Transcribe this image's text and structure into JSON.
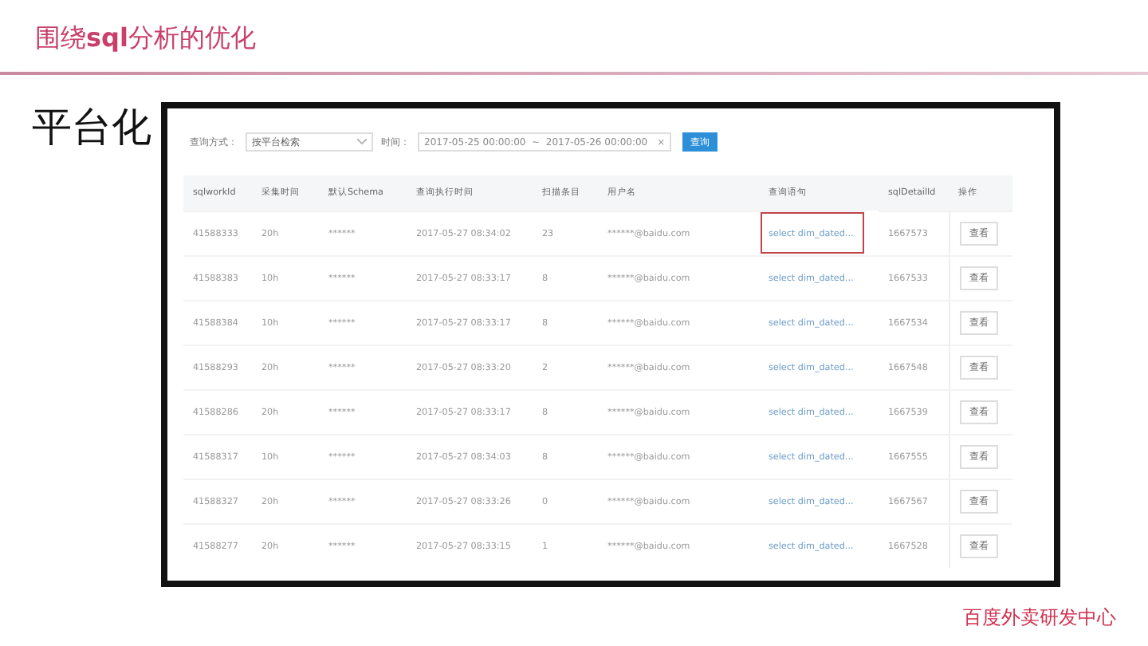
{
  "slide": {
    "title": "围绕**sql**分析的优化",
    "subtitle": "平台化",
    "footer": "百度外卖研发中心"
  },
  "filter": {
    "mode_label": "查询方式：",
    "mode_value": "按平台检索",
    "time_label": "时间：",
    "time_value": "2017-05-25 00:00:00  ~  2017-05-26 00:00:00",
    "clear": "×",
    "search_button": "查询"
  },
  "table": {
    "columns": [
      "sqlworkId",
      "采集时间",
      "默认Schema",
      "查询执行时间",
      "扫描条目",
      "用户名",
      "查询语句",
      "sqlDetailId",
      "操作"
    ],
    "rows": [
      {
        "cells": [
          "41588333",
          "20h",
          "******",
          "2017-05-27 08:34:02",
          "23",
          "******@baidu.com",
          "select dim_dated...",
          "1667573"
        ],
        "action": "查看",
        "highlighted": true
      },
      {
        "cells": [
          "41588383",
          "10h",
          "******",
          "2017-05-27 08:33:17",
          "8",
          "******@baidu.com",
          "select dim_dated...",
          "1667533"
        ],
        "action": "查看",
        "highlighted": false
      },
      {
        "cells": [
          "41588384",
          "10h",
          "******",
          "2017-05-27 08:33:17",
          "8",
          "******@baidu.com",
          "select dim_dated...",
          "1667534"
        ],
        "action": "查看",
        "highlighted": false
      },
      {
        "cells": [
          "41588293",
          "20h",
          "******",
          "2017-05-27 08:33:20",
          "2",
          "******@baidu.com",
          "select dim_dated...",
          "1667548"
        ],
        "action": "查看",
        "highlighted": false
      },
      {
        "cells": [
          "41588286",
          "20h",
          "******",
          "2017-05-27 08:33:17",
          "8",
          "******@baidu.com",
          "select dim_dated...",
          "1667539"
        ],
        "action": "查看",
        "highlighted": false
      },
      {
        "cells": [
          "41588317",
          "10h",
          "******",
          "2017-05-27 08:34:03",
          "8",
          "******@baidu.com",
          "select dim_dated...",
          "1667555"
        ],
        "action": "查看",
        "highlighted": false
      },
      {
        "cells": [
          "41588327",
          "20h",
          "******",
          "2017-05-27 08:33:26",
          "0",
          "******@baidu.com",
          "select dim_dated...",
          "1667567"
        ],
        "action": "查看",
        "highlighted": false
      },
      {
        "cells": [
          "41588277",
          "20h",
          "******",
          "2017-05-27 08:33:15",
          "1",
          "******@baidu.com",
          "select dim_dated...",
          "1667528"
        ],
        "action": "查看",
        "highlighted": false
      }
    ]
  }
}
